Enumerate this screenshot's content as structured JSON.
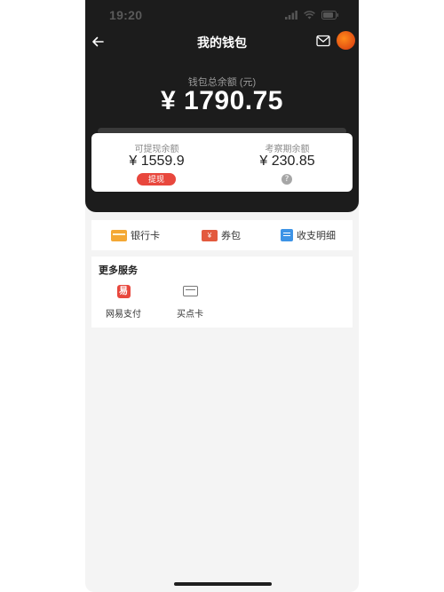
{
  "status_bar": {
    "time": "19:20"
  },
  "header": {
    "title": "我的钱包"
  },
  "wallet": {
    "total_label": "钱包总余额 (元)",
    "total_value": "¥ 1790.75",
    "withdrawable_label": "可提现余额",
    "withdrawable_value": "¥ 1559.9",
    "withdraw_button": "提现",
    "review_label": "考察期余额",
    "review_value": "¥ 230.85"
  },
  "quick_actions": [
    {
      "label": "银行卡",
      "icon": "bank-card-icon"
    },
    {
      "label": "券包",
      "icon": "coupon-icon"
    },
    {
      "label": "收支明细",
      "icon": "bill-icon"
    }
  ],
  "services": {
    "title": "更多服务",
    "items": [
      {
        "label": "网易支付",
        "icon": "netease-pay-icon"
      },
      {
        "label": "买点卡",
        "icon": "card-icon"
      }
    ]
  },
  "colors": {
    "header_bg": "#1c1c1c",
    "accent_red": "#e8473d",
    "page_bg": "#f4f4f4"
  }
}
